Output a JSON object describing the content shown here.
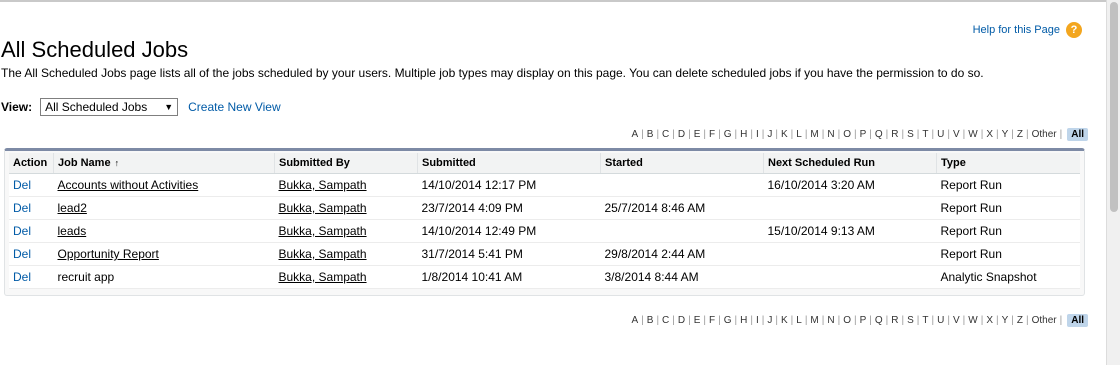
{
  "page": {
    "title": "All Scheduled Jobs",
    "help_link": "Help for this Page",
    "help_icon": "help-icon",
    "description": "The All Scheduled Jobs page lists all of the jobs scheduled by your users. Multiple job types may display on this page. You can delete scheduled jobs if you have the permission to do so."
  },
  "view": {
    "label": "View:",
    "selected": "All Scheduled Jobs",
    "create_link": "Create New View"
  },
  "alphabet": [
    "A",
    "B",
    "C",
    "D",
    "E",
    "F",
    "G",
    "H",
    "I",
    "J",
    "K",
    "L",
    "M",
    "N",
    "O",
    "P",
    "Q",
    "R",
    "S",
    "T",
    "U",
    "V",
    "W",
    "X",
    "Y",
    "Z",
    "Other"
  ],
  "alphabet_all": "All",
  "table": {
    "headers": [
      "Action",
      "Job Name",
      "Submitted By",
      "Submitted",
      "Started",
      "Next Scheduled Run",
      "Type"
    ],
    "sort_indicator": "↑",
    "rows": [
      {
        "action": "Del",
        "job_name": "Accounts without Activities",
        "submitted_by": "Bukka, Sampath",
        "submitted": "14/10/2014 12:17 PM",
        "started": "",
        "next_run": "16/10/2014 3:20 AM",
        "type": "Report Run"
      },
      {
        "action": "Del",
        "job_name": "lead2",
        "submitted_by": "Bukka, Sampath",
        "submitted": "23/7/2014 4:09 PM",
        "started": "25/7/2014 8:46 AM",
        "next_run": "",
        "type": "Report Run"
      },
      {
        "action": "Del",
        "job_name": "leads",
        "submitted_by": "Bukka, Sampath",
        "submitted": "14/10/2014 12:49 PM",
        "started": "",
        "next_run": "15/10/2014 9:13 AM",
        "type": "Report Run"
      },
      {
        "action": "Del",
        "job_name": "Opportunity Report",
        "submitted_by": "Bukka, Sampath",
        "submitted": "31/7/2014 5:41 PM",
        "started": "29/8/2014 2:44 AM",
        "next_run": "",
        "type": "Report Run"
      },
      {
        "action": "Del",
        "job_name": "recruit app",
        "submitted_by": "Bukka, Sampath",
        "submitted": "1/8/2014 10:41 AM",
        "started": "3/8/2014 8:44 AM",
        "next_run": "",
        "type": "Analytic Snapshot"
      }
    ],
    "linked_job_names": [
      true,
      true,
      true,
      true,
      false
    ]
  },
  "colors": {
    "link": "#015ba7",
    "help_icon": "#f3a61f",
    "alpha_all_bg": "#bfd5ea",
    "table_top_border": "#7d8aa5"
  }
}
